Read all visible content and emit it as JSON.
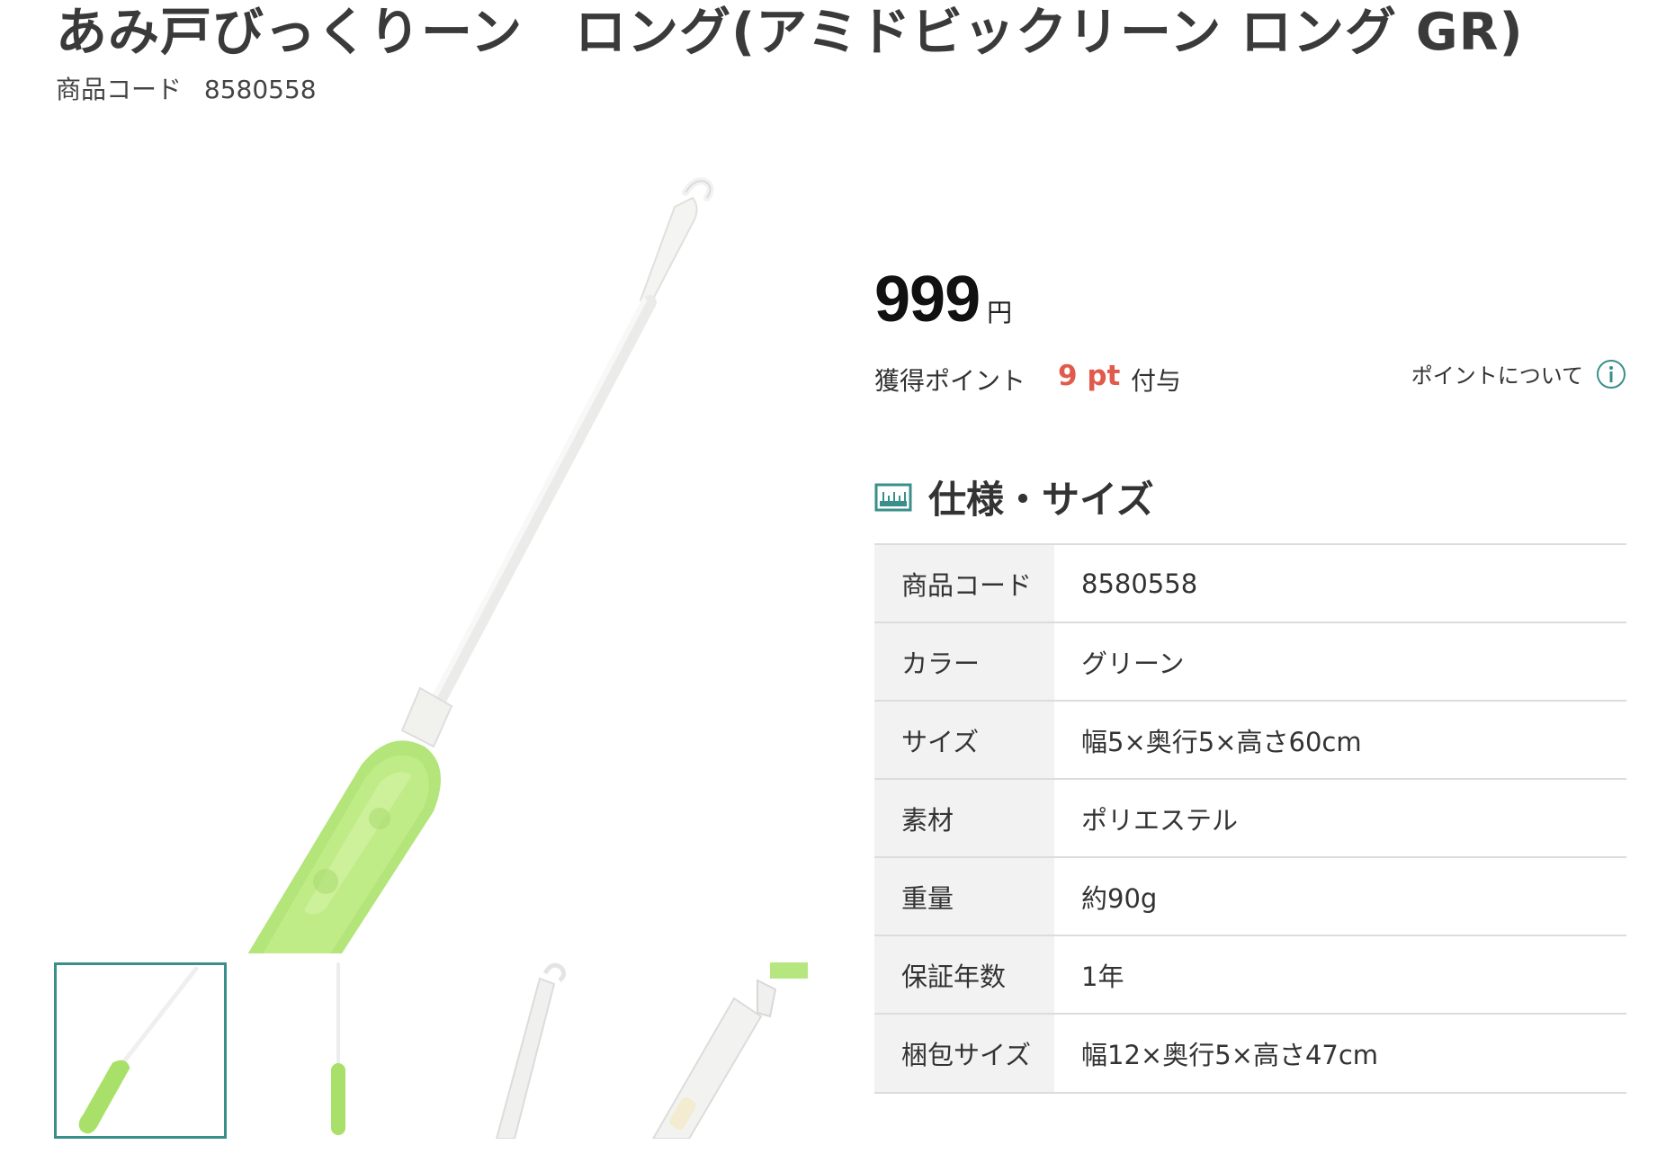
{
  "product": {
    "title": "あみ戸びっくりーン　ロング(アミドビックリーン ロング GR)",
    "code_label": "商品コード",
    "code_value": "8580558"
  },
  "price": {
    "value": "999",
    "unit": "円"
  },
  "points": {
    "label": "獲得ポイント",
    "value": "9 pt",
    "suffix": "付与",
    "info_link": "ポイントについて"
  },
  "spec": {
    "heading": "仕様・サイズ",
    "rows": [
      {
        "key": "商品コード",
        "value": "8580558"
      },
      {
        "key": "カラー",
        "value": "グリーン"
      },
      {
        "key": "サイズ",
        "value": "幅5×奥行5×高さ60cm"
      },
      {
        "key": "素材",
        "value": "ポリエステル"
      },
      {
        "key": "重量",
        "value": "約90g"
      },
      {
        "key": "保証年数",
        "value": "1年"
      },
      {
        "key": "梱包サイズ",
        "value": "幅12×奥行5×高さ47cm"
      }
    ]
  },
  "thumbnails": {
    "count": 4,
    "selected_index": 0
  },
  "colors": {
    "accent_teal": "#3a8f8a",
    "points_red": "#e05b4c",
    "product_green": "#a8e06a",
    "table_key_bg": "#f2f2f2"
  },
  "icons": {
    "info": "info-icon",
    "spec": "ruler-icon"
  }
}
